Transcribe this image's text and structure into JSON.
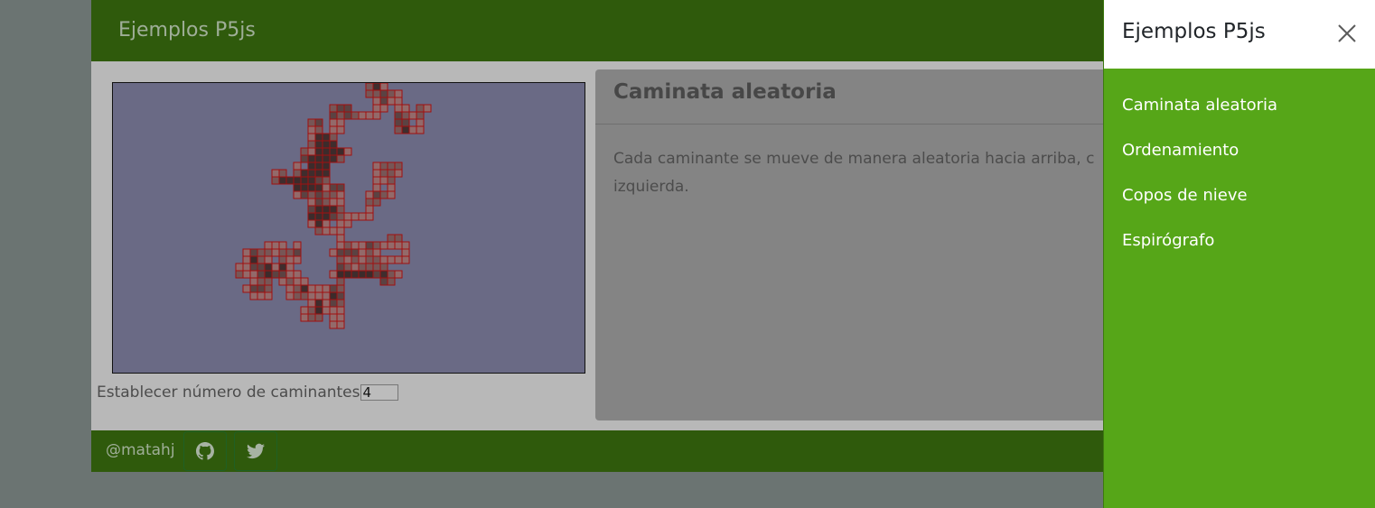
{
  "navbar": {
    "brand": "Ejemplos P5js"
  },
  "controls": {
    "walker_label": "Establecer número de caminantes",
    "walker_count": "4"
  },
  "card": {
    "title": "Caminata aleatoria",
    "description": "Cada caminante se mueve de manera aleatoria hacia arriba, c izquierda."
  },
  "footer": {
    "handle": "@matahj",
    "icons": [
      "github-icon",
      "twitter-icon"
    ]
  },
  "offcanvas": {
    "title": "Ejemplos P5js",
    "close_icon": "close-icon",
    "items": [
      {
        "label": "Caminata aleatoria"
      },
      {
        "label": "Ordenamiento"
      },
      {
        "label": "Copos de nieve"
      },
      {
        "label": "Espirógrafo"
      }
    ]
  },
  "colors": {
    "navbar": "#2f5a0c",
    "offcanvas": "#56a618",
    "canvas_bg": "#6a6a85",
    "cell_fill": "#a87878",
    "cell_stroke": "#a01010"
  }
}
